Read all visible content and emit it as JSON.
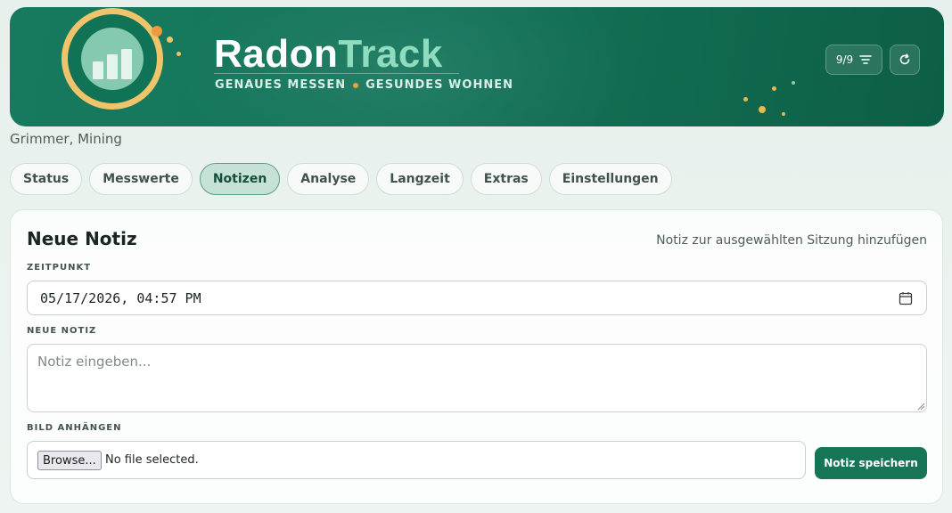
{
  "header": {
    "brand_part1": "Radon",
    "brand_part2": "Track",
    "tagline_left": "GENAUES MESSEN",
    "tagline_right": "GESUNDES WOHNEN",
    "filter_count": "9/9",
    "filter_icon": "filter-lines-icon",
    "refresh_icon": "refresh-icon",
    "logo_icon": "bar-chart-logo-icon"
  },
  "location": "Grimmer, Mining",
  "tabs": [
    {
      "label": "Status",
      "active": false
    },
    {
      "label": "Messwerte",
      "active": false
    },
    {
      "label": "Notizen",
      "active": true
    },
    {
      "label": "Analyse",
      "active": false
    },
    {
      "label": "Langzeit",
      "active": false
    },
    {
      "label": "Extras",
      "active": false
    },
    {
      "label": "Einstellungen",
      "active": false
    }
  ],
  "note_form": {
    "title": "Neue Notiz",
    "hint": "Notiz zur ausgewählten Sitzung hinzufügen",
    "timestamp_label": "ZEITPUNKT",
    "timestamp_value": "05/17/2026, 04:57 PM",
    "calendar_icon": "calendar-icon",
    "note_label": "NEUE NOTIZ",
    "note_placeholder": "Notiz eingeben...",
    "note_value": "",
    "attach_label": "BILD ANHÄNGEN",
    "browse_label": "Browse...",
    "file_status": "No file selected.",
    "save_label": "Notiz speichern"
  },
  "colors": {
    "header_bg": "#177a5e",
    "brand_accent": "#8fdcbf",
    "logo_ring": "#f0c46a",
    "separator_dot": "#f0a23a",
    "primary_button": "#177456",
    "active_tab_bg": "#c6e2d6"
  }
}
